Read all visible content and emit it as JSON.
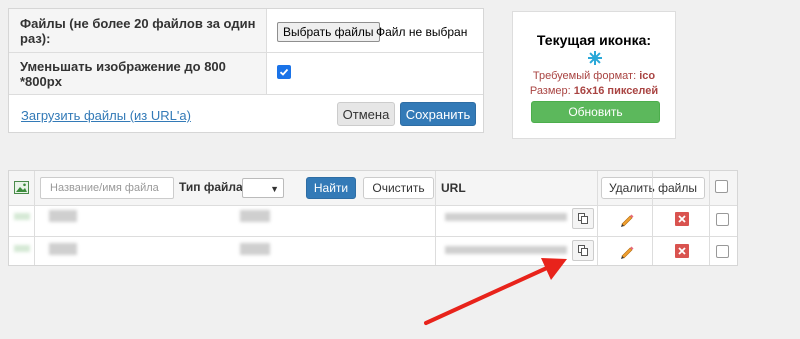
{
  "upload_form": {
    "files_label": "Файлы (не более 20 файлов за один раз):",
    "choose_button": "Выбрать файлы",
    "no_file_text": "Файл не выбран",
    "resize_label": "Уменьшать изображение до 800 *800px",
    "resize_checked": true,
    "url_link": "Загрузить файлы (из URL'а)",
    "cancel_button": "Отмена",
    "save_button": "Сохранить"
  },
  "current_icon": {
    "title": "Текущая иконка:",
    "format_label": "Требуемый формат:",
    "format_value": "ico",
    "size_label": "Размер:",
    "size_value": "16x16 пикселей",
    "update_button": "Обновить"
  },
  "files_table": {
    "name_placeholder": "Название/имя файла",
    "type_label": "Тип файла",
    "find_button": "Найти",
    "clear_button": "Очистить",
    "url_header": "URL",
    "delete_files_button": "Удалить файлы",
    "row_count": 2
  },
  "colors": {
    "primary": "#337ab7",
    "success": "#5cb85c",
    "danger": "#d9534f",
    "link": "#337ab7",
    "annotation_arrow": "#e8231b"
  },
  "icons": [
    "image-icon",
    "checkbox-checked-icon",
    "favicon-icon",
    "copy-icon",
    "pencil-icon",
    "delete-icon",
    "arrow-annotation"
  ]
}
